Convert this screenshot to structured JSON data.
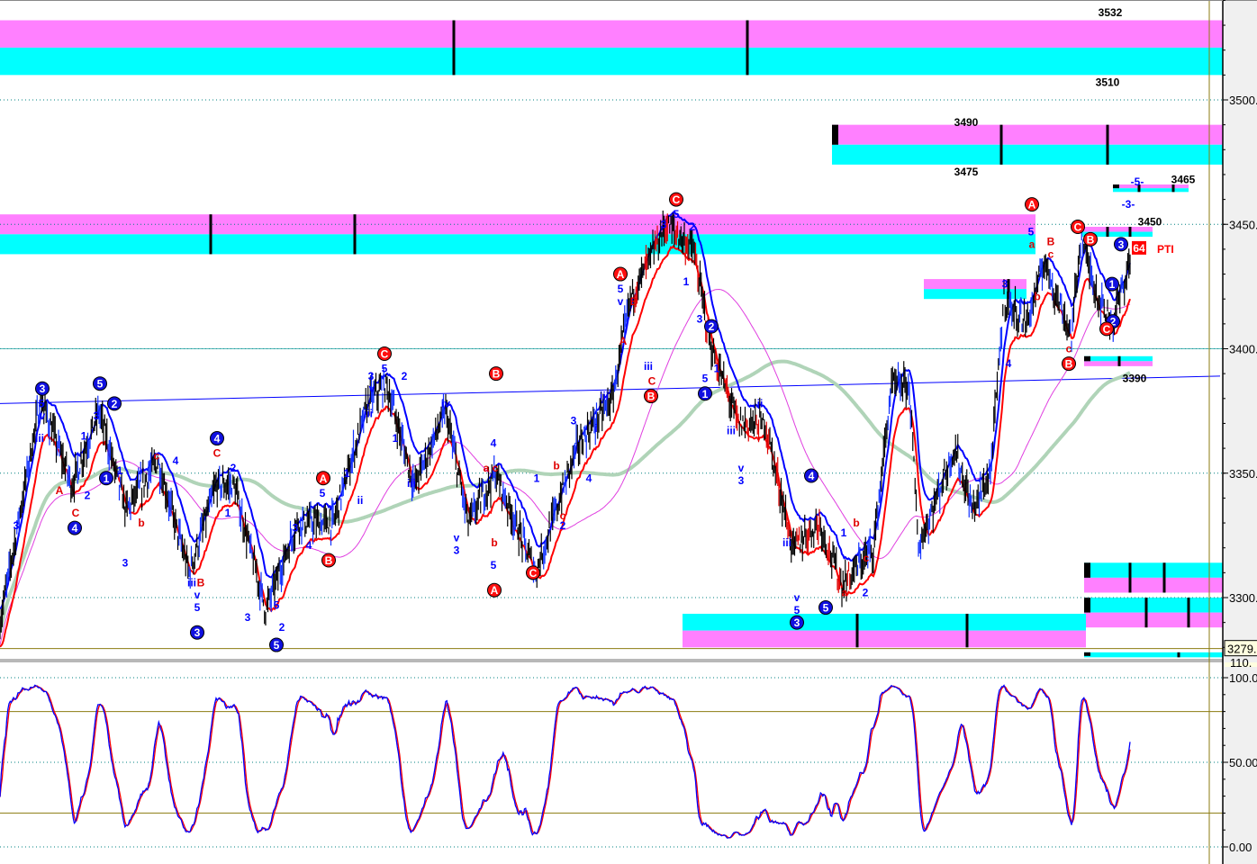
{
  "chart_data": {
    "type": "candlestick",
    "price_axis": {
      "ticks": [
        "3500.",
        "3450.",
        "3400.",
        "3350.",
        "3300."
      ],
      "tick_values": [
        3500,
        3450,
        3400,
        3350,
        3300
      ],
      "ylim": [
        3274,
        3540
      ],
      "last_price_tag": "3279."
    },
    "oscillator_axis": {
      "ticks": [
        "100.0",
        "50.00",
        "0.00"
      ],
      "tick_values": [
        100,
        50,
        0
      ],
      "top_partial": "110.",
      "levels": [
        80,
        20
      ],
      "ylim": [
        -5,
        110
      ]
    },
    "price_path": [
      [
        0,
        3290
      ],
      [
        9,
        3380
      ],
      [
        16,
        3345
      ],
      [
        22,
        3375
      ],
      [
        28,
        3335
      ],
      [
        35,
        3355
      ],
      [
        42,
        3310
      ],
      [
        48,
        3345
      ],
      [
        52,
        3345
      ],
      [
        59,
        3295
      ],
      [
        66,
        3330
      ],
      [
        74,
        3330
      ],
      [
        82,
        3380
      ],
      [
        86,
        3385
      ],
      [
        92,
        3345
      ],
      [
        99,
        3375
      ],
      [
        104,
        3330
      ],
      [
        110,
        3350
      ],
      [
        119,
        3310
      ],
      [
        128,
        3360
      ],
      [
        136,
        3380
      ],
      [
        140,
        3420
      ],
      [
        148,
        3450
      ],
      [
        154,
        3440
      ],
      [
        158,
        3400
      ],
      [
        164,
        3370
      ],
      [
        170,
        3370
      ],
      [
        176,
        3320
      ],
      [
        182,
        3330
      ],
      [
        187,
        3305
      ],
      [
        194,
        3320
      ],
      [
        198,
        3385
      ],
      [
        202,
        3385
      ],
      [
        204,
        3320
      ],
      [
        212,
        3360
      ],
      [
        216,
        3335
      ],
      [
        220,
        3350
      ],
      [
        223,
        3420
      ],
      [
        228,
        3410
      ],
      [
        232,
        3435
      ],
      [
        238,
        3405
      ],
      [
        240,
        3445
      ],
      [
        244,
        3420
      ],
      [
        247,
        3410
      ],
      [
        251,
        3435
      ]
    ],
    "trendline": {
      "from": [
        0,
        3378
      ],
      "to": [
        271,
        3389
      ]
    },
    "hline": 3400,
    "zones": [
      {
        "top": 3532,
        "bottom": 3510,
        "from": 0,
        "to": 272,
        "marks": [
          100.8,
          166
        ],
        "order": "magenta-cyan"
      },
      {
        "top": 3490,
        "bottom": 3474,
        "from": 184.8,
        "to": 272,
        "marks": [
          222.4,
          246
        ],
        "block": true,
        "order": "magenta-cyan"
      },
      {
        "top": 3466,
        "bottom": 3463,
        "from": 247.2,
        "to": 264,
        "marks": [
          253,
          260.6
        ],
        "block": true,
        "order": "magenta-cyan"
      },
      {
        "top": 3454,
        "bottom": 3438,
        "from": 0,
        "to": 230,
        "marks": [
          46.8,
          78.8
        ],
        "order": "magenta-cyan"
      },
      {
        "top": 3449,
        "bottom": 3445,
        "from": 240.4,
        "to": 256,
        "marks": [
          246,
          251
        ],
        "order": "magenta-cyan"
      },
      {
        "top": 3428,
        "bottom": 3420,
        "from": 205.2,
        "to": 228,
        "marks": [
          224
        ],
        "order": "magenta-cyan"
      },
      {
        "top": 3397,
        "bottom": 3393,
        "from": 240.8,
        "to": 256,
        "marks": [
          248.6
        ],
        "block": true,
        "order": "cyan-magenta"
      },
      {
        "top": 3314,
        "bottom": 3302,
        "from": 240.8,
        "to": 272,
        "marks": [
          251,
          258.6
        ],
        "block": true,
        "order": "cyan-magenta"
      },
      {
        "top": 3300,
        "bottom": 3288,
        "from": 240.8,
        "to": 272,
        "marks": [
          254.6,
          264
        ],
        "block": true,
        "order": "cyan-magenta"
      },
      {
        "top": 3293.5,
        "bottom": 3280,
        "from": 151.6,
        "to": 241.2,
        "marks": [
          190.4,
          214.8
        ],
        "order": "cyan-magenta"
      },
      {
        "top": 3278,
        "bottom": 3276,
        "from": 240.8,
        "to": 272,
        "marks": [
          261.8
        ],
        "block": true,
        "order": "cyan"
      }
    ],
    "annotations": [
      [
        "3532",
        246.6,
        3535,
        "k"
      ],
      [
        "3510",
        246,
        3507,
        "k"
      ],
      [
        "3490",
        214.6,
        3491,
        "k"
      ],
      [
        "3475",
        214.6,
        3471,
        "k"
      ],
      [
        "3465",
        262.8,
        3468,
        "k"
      ],
      [
        "3450",
        255.4,
        3451,
        "k"
      ],
      [
        "3390",
        252,
        3388,
        "k"
      ],
      [
        "PTI",
        257,
        3440,
        "pti"
      ],
      [
        "64",
        253,
        3440,
        "tag"
      ],
      [
        "3",
        9.4,
        3384,
        "cb"
      ],
      [
        "5",
        22.2,
        3386,
        "cb"
      ],
      [
        "2",
        25.4,
        3378,
        "cb"
      ],
      [
        "1",
        23.6,
        3348,
        "cb"
      ],
      [
        "4",
        16.6,
        3328,
        "cb"
      ],
      [
        "4",
        48.2,
        3364,
        "cb"
      ],
      [
        "3",
        43.8,
        3286,
        "cb"
      ],
      [
        "5",
        61.4,
        3281,
        "cb"
      ],
      [
        "A",
        71.8,
        3348,
        "cr"
      ],
      [
        "B",
        73,
        3315,
        "cr"
      ],
      [
        "C",
        85.4,
        3398,
        "cr"
      ],
      [
        "B",
        110.2,
        3390,
        "cr"
      ],
      [
        "A",
        109.8,
        3303,
        "cr"
      ],
      [
        "C",
        118.4,
        3310,
        "cr"
      ],
      [
        "A",
        137.8,
        3430,
        "cr"
      ],
      [
        "B",
        144.6,
        3381,
        "cr"
      ],
      [
        "C",
        150.2,
        3460,
        "cr"
      ],
      [
        "2",
        158,
        3409,
        "cb"
      ],
      [
        "1",
        156.6,
        3382,
        "cb"
      ],
      [
        "4",
        180.2,
        3349,
        "cb"
      ],
      [
        "3",
        177,
        3290,
        "cb"
      ],
      [
        "5",
        183.4,
        3296,
        "cb"
      ],
      [
        "A",
        229.2,
        3458,
        "cr"
      ],
      [
        "B",
        237.4,
        3394,
        "cr"
      ],
      [
        "C",
        239.4,
        3449,
        "cr"
      ],
      [
        "B",
        242.2,
        3444,
        "cr"
      ],
      [
        "3",
        249,
        3442,
        "cb"
      ],
      [
        "1",
        247,
        3426,
        "cb"
      ],
      [
        "2",
        247.2,
        3411,
        "cb"
      ],
      [
        "C",
        245.8,
        3408,
        "cr"
      ],
      [
        "5",
        9.2,
        3378,
        "b"
      ],
      [
        "v",
        9.4,
        3373,
        "b"
      ],
      [
        "iii",
        8.8,
        3364,
        "b"
      ],
      [
        "3",
        3.6,
        3329,
        "b"
      ],
      [
        "A",
        13.2,
        3343,
        "r"
      ],
      [
        "C",
        16.8,
        3334,
        "r"
      ],
      [
        "1",
        18.6,
        3365,
        "b"
      ],
      [
        "3",
        21.4,
        3373,
        "b"
      ],
      [
        "2",
        19.4,
        3341,
        "b"
      ],
      [
        "1",
        26.6,
        3351,
        "b"
      ],
      [
        "b",
        31.4,
        3330,
        "r"
      ],
      [
        "3",
        27.8,
        3314,
        "b"
      ],
      [
        "c",
        34.8,
        3357,
        "r"
      ],
      [
        "4",
        39,
        3355,
        "b"
      ],
      [
        "C",
        48.2,
        3358,
        "r"
      ],
      [
        "2",
        51.8,
        3352,
        "b"
      ],
      [
        "1",
        50.6,
        3334,
        "b"
      ],
      [
        "iii",
        42.6,
        3306,
        "b"
      ],
      [
        "B",
        44.6,
        3306,
        "r"
      ],
      [
        "v",
        43.8,
        3301,
        "b"
      ],
      [
        "5",
        43.8,
        3296,
        "b"
      ],
      [
        "3",
        55,
        3292,
        "b"
      ],
      [
        "5",
        61.4,
        3297,
        "b"
      ],
      [
        "2",
        62.6,
        3288,
        "b"
      ],
      [
        "5",
        71.6,
        3342,
        "b"
      ],
      [
        "3",
        65.6,
        3328,
        "b"
      ],
      [
        "4",
        68.6,
        3321,
        "b"
      ],
      [
        "1",
        77,
        3350,
        "b"
      ],
      [
        "ii",
        80,
        3339,
        "b"
      ],
      [
        "3",
        82.4,
        3389,
        "b"
      ],
      [
        "v",
        82.6,
        3384,
        "b"
      ],
      [
        "5",
        85.4,
        3392,
        "b"
      ],
      [
        "2",
        89.8,
        3389,
        "b"
      ],
      [
        "iii",
        81.8,
        3374,
        "b"
      ],
      [
        "1",
        87.8,
        3364,
        "b"
      ],
      [
        "iii",
        91.4,
        3346,
        "b"
      ],
      [
        "iv",
        99,
        3378,
        "b"
      ],
      [
        "v",
        101.4,
        3324,
        "b"
      ],
      [
        "3",
        101.4,
        3319,
        "b"
      ],
      [
        "5",
        109.6,
        3313,
        "b"
      ],
      [
        "b",
        109.8,
        3322,
        "r"
      ],
      [
        "a",
        108,
        3352,
        "r"
      ],
      [
        "c",
        110,
        3352,
        "r"
      ],
      [
        "4",
        109.6,
        3362,
        "b"
      ],
      [
        "1",
        119.2,
        3348,
        "b"
      ],
      [
        "b",
        123.6,
        3353,
        "r"
      ],
      [
        "c",
        125,
        3333,
        "r"
      ],
      [
        "2",
        125,
        3329,
        "b"
      ],
      [
        "3",
        127.4,
        3371,
        "b"
      ],
      [
        "i",
        132.4,
        3368,
        "b"
      ],
      [
        "iii",
        134.2,
        3381,
        "b"
      ],
      [
        "4",
        130.8,
        3348,
        "b"
      ],
      [
        "5",
        137.8,
        3424,
        "b"
      ],
      [
        "v",
        137.8,
        3419,
        "b"
      ],
      [
        "A",
        138.4,
        3403,
        "r"
      ],
      [
        "B",
        140.8,
        3419,
        "r"
      ],
      [
        "iii",
        144,
        3393,
        "b"
      ],
      [
        "C",
        144.8,
        3387,
        "r"
      ],
      [
        "3",
        147.4,
        3450,
        "b"
      ],
      [
        "5",
        150.2,
        3454,
        "b"
      ],
      [
        "2",
        153.8,
        3449,
        "b"
      ],
      [
        "1",
        152.4,
        3427,
        "b"
      ],
      [
        "3",
        155.4,
        3412,
        "b"
      ],
      [
        "5",
        156.6,
        3388,
        "b"
      ],
      [
        "1",
        159.2,
        3392,
        "b"
      ],
      [
        "ii",
        168.8,
        3378,
        "b"
      ],
      [
        "iii",
        162.4,
        3367,
        "b"
      ],
      [
        "v",
        164.6,
        3352,
        "b"
      ],
      [
        "3",
        164.6,
        3347,
        "b"
      ],
      [
        "iii",
        174.8,
        3322,
        "b"
      ],
      [
        "v",
        177,
        3300,
        "b"
      ],
      [
        "5",
        177,
        3295,
        "b"
      ],
      [
        "1",
        187.4,
        3326,
        "b"
      ],
      [
        "a",
        187.6,
        3302,
        "r"
      ],
      [
        "b",
        190.2,
        3330,
        "r"
      ],
      [
        "c",
        192.4,
        3316,
        "r"
      ],
      [
        "2",
        192.2,
        3302,
        "b"
      ],
      [
        "3",
        223.2,
        3426,
        "b"
      ],
      [
        "4",
        224,
        3394,
        "b"
      ],
      [
        "5",
        229,
        3447,
        "b"
      ],
      [
        "a",
        229.2,
        3442,
        "r"
      ],
      [
        "b",
        230.4,
        3421,
        "r"
      ],
      [
        "B",
        233.4,
        3443,
        "r"
      ],
      [
        "c",
        233.4,
        3438,
        "r"
      ],
      [
        "c",
        237.4,
        3400,
        "r"
      ],
      [
        "-5-",
        252.6,
        3467,
        "b"
      ],
      [
        "-3-",
        250.6,
        3458,
        "b"
      ]
    ]
  },
  "colors": {
    "magenta": "#ff80ff",
    "cyan": "#00ffff",
    "blue": "#0000ff",
    "red": "#ff0000",
    "green_ma": "#b0d4b8",
    "thin_ma": "#e040e0",
    "olive": "#8b7b10",
    "grid": "#008080",
    "axis_bg": "#f0f0f0"
  }
}
